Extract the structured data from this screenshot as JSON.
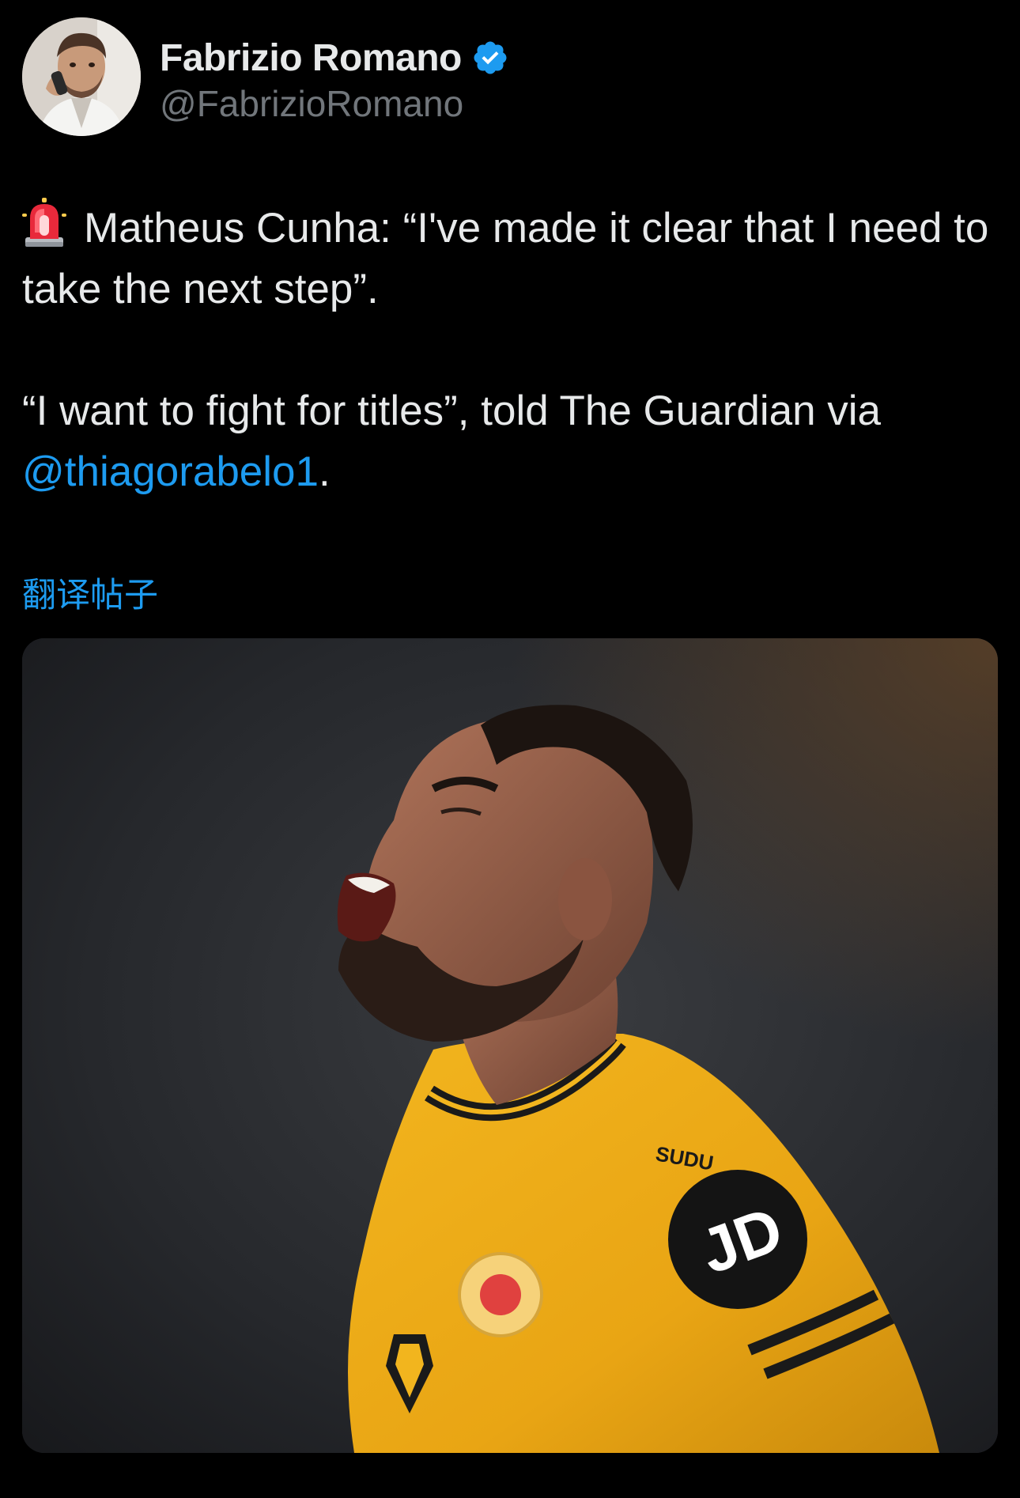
{
  "author": {
    "display_name": "Fabrizio Romano",
    "handle": "@FabrizioRomano",
    "verified": true,
    "avatar_icon": "profile-photo"
  },
  "tweet": {
    "emoji_icon": "police-siren-emoji",
    "line1_text": "Matheus Cunha: “I've made it clear that I need to take the next step”.",
    "line2_text": "“I want to fight for titles”, told The Guardian via ",
    "mention": "@thiagorabelo1",
    "line2_end": "."
  },
  "translate_link": "翻译帖子",
  "media": {
    "type": "photo",
    "shirt_text": "SUDU",
    "badge_text": "JD"
  },
  "colors": {
    "background": "#000000",
    "text": "#e7e9ea",
    "secondary": "#71767b",
    "link": "#1d9bf0",
    "verified": "#1d9bf0"
  }
}
